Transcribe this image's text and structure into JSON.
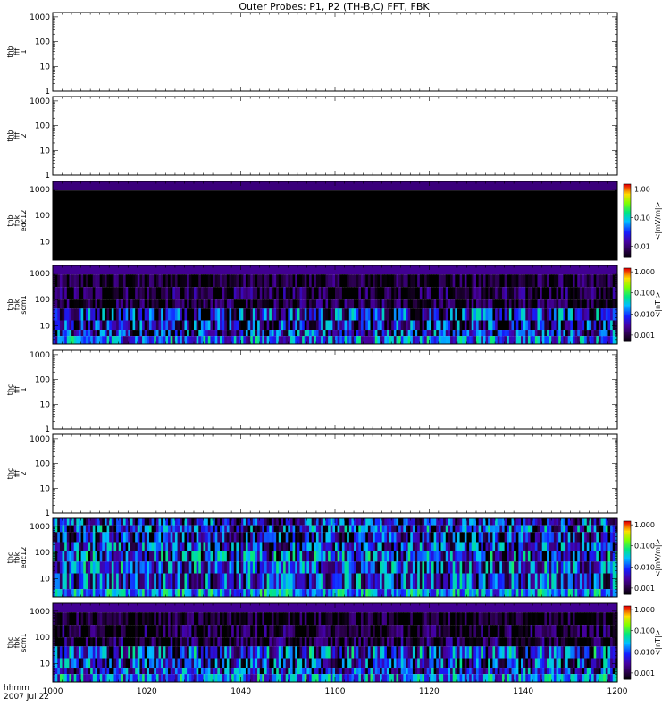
{
  "title": "Outer Probes: P1, P2 (TH-B,C) FFT, FBK",
  "footer": {
    "line1": "hhmm",
    "line2": "2007 Jul 22"
  },
  "colorbars": {
    "efield": {
      "unit": "<|mV/m|>",
      "ticks": [
        "1.00",
        "0.10",
        "0.01"
      ]
    },
    "efield_b": {
      "unit": "<|mV/m|>",
      "ticks": [
        "1.000",
        "0.100",
        "0.010",
        "0.001"
      ]
    },
    "bfield": {
      "unit": "<|nT|>",
      "ticks": [
        "1.000",
        "0.100",
        "0.010",
        "0.001"
      ]
    }
  },
  "chart_data": [
    {
      "type": "heatmap",
      "panel": "thb-fff-1",
      "ylabel": [
        "thb",
        "fff",
        "1"
      ],
      "yscale": "log",
      "ylim": [
        1,
        1500
      ],
      "ytick_labels": [
        "1000",
        "100",
        "10",
        "1"
      ],
      "xlim": [
        1000,
        1200
      ],
      "has_data": false,
      "colorbar": null
    },
    {
      "type": "heatmap",
      "panel": "thb-fff-2",
      "ylabel": [
        "thb",
        "fff",
        "2"
      ],
      "yscale": "log",
      "ylim": [
        1,
        1500
      ],
      "ytick_labels": [
        "1000",
        "100",
        "10",
        "1"
      ],
      "xlim": [
        1000,
        1200
      ],
      "has_data": false,
      "colorbar": null
    },
    {
      "type": "heatmap",
      "panel": "thb-fbk-edc12",
      "ylabel": [
        "thb",
        "fbk",
        "edc12"
      ],
      "yscale": "log",
      "ylim": [
        2,
        2000
      ],
      "ytick_labels": [
        "1000",
        "100",
        "10"
      ],
      "xlim": [
        1000,
        1200
      ],
      "has_data": true,
      "colorbar": "efield",
      "color_scale": "log",
      "zlim": [
        0.004,
        1.5
      ],
      "bands": [
        {
          "yrange": [
            900,
            2000
          ],
          "level": 0.011,
          "noise": 0.0
        },
        {
          "yrange": [
            2,
            900
          ],
          "level": 0.0,
          "noise": 0.0
        }
      ]
    },
    {
      "type": "heatmap",
      "panel": "thb-fbk-scm1",
      "ylabel": [
        "thb",
        "fbk",
        "scm1"
      ],
      "yscale": "log",
      "ylim": [
        2,
        2000
      ],
      "ytick_labels": [
        "1000",
        "100",
        "10"
      ],
      "xlim": [
        1000,
        1200
      ],
      "has_data": true,
      "colorbar": "bfield",
      "color_scale": "log",
      "zlim": [
        0.0005,
        1.5
      ],
      "bands": [
        {
          "yrange": [
            900,
            2000
          ],
          "level": 0.0025,
          "noise": 0.0
        },
        {
          "yrange": [
            300,
            900
          ],
          "level": 0.0008,
          "noise": 0.25
        },
        {
          "yrange": [
            100,
            300
          ],
          "level": 0.0009,
          "noise": 0.3
        },
        {
          "yrange": [
            45,
            100
          ],
          "level": 0.0008,
          "noise": 0.3
        },
        {
          "yrange": [
            16,
            45
          ],
          "level": 0.004,
          "noise": 0.55
        },
        {
          "yrange": [
            7,
            16
          ],
          "level": 0.003,
          "noise": 0.55
        },
        {
          "yrange": [
            4,
            7
          ],
          "level": 0.004,
          "noise": 0.5
        },
        {
          "yrange": [
            2,
            4
          ],
          "level": 0.012,
          "noise": 0.4
        }
      ]
    },
    {
      "type": "heatmap",
      "panel": "thc-fff-1",
      "ylabel": [
        "thc",
        "fff",
        "1"
      ],
      "yscale": "log",
      "ylim": [
        1,
        1500
      ],
      "ytick_labels": [
        "1000",
        "100",
        "10",
        "1"
      ],
      "xlim": [
        1000,
        1200
      ],
      "has_data": false,
      "colorbar": null
    },
    {
      "type": "heatmap",
      "panel": "thc-fff-2",
      "ylabel": [
        "thc",
        "fff",
        "2"
      ],
      "yscale": "log",
      "ylim": [
        1,
        1500
      ],
      "ytick_labels": [
        "1000",
        "100",
        "10",
        "1"
      ],
      "xlim": [
        1000,
        1200
      ],
      "has_data": false,
      "colorbar": null
    },
    {
      "type": "heatmap",
      "panel": "thc-fbk-edc12",
      "ylabel": [
        "thc",
        "fbk",
        "edc12"
      ],
      "yscale": "log",
      "ylim": [
        2,
        2000
      ],
      "ytick_labels": [
        "1000",
        "100",
        "10"
      ],
      "xlim": [
        1000,
        1200
      ],
      "has_data": true,
      "colorbar": "efield_b",
      "color_scale": "log",
      "zlim": [
        0.0005,
        1.5
      ],
      "bands": [
        {
          "yrange": [
            1100,
            2000
          ],
          "level": 0.004,
          "noise": 0.5
        },
        {
          "yrange": [
            600,
            1100
          ],
          "level": 0.005,
          "noise": 0.55
        },
        {
          "yrange": [
            250,
            600
          ],
          "level": 0.003,
          "noise": 0.5
        },
        {
          "yrange": [
            110,
            250
          ],
          "level": 0.004,
          "noise": 0.55
        },
        {
          "yrange": [
            45,
            110
          ],
          "level": 0.006,
          "noise": 0.55
        },
        {
          "yrange": [
            16,
            45
          ],
          "level": 0.007,
          "noise": 0.5
        },
        {
          "yrange": [
            4,
            16
          ],
          "level": 0.006,
          "noise": 0.5
        },
        {
          "yrange": [
            2,
            4
          ],
          "level": 0.02,
          "noise": 0.35
        }
      ]
    },
    {
      "type": "heatmap",
      "panel": "thc-fbk-scm1",
      "ylabel": [
        "thc",
        "fbk",
        "scm1"
      ],
      "yscale": "log",
      "ylim": [
        2,
        2000
      ],
      "ytick_labels": [
        "1000",
        "100",
        "10"
      ],
      "xlim": [
        1000,
        1200
      ],
      "has_data": true,
      "colorbar": "bfield",
      "color_scale": "log",
      "zlim": [
        0.0005,
        1.5
      ],
      "bands": [
        {
          "yrange": [
            900,
            2000
          ],
          "level": 0.0025,
          "noise": 0.0
        },
        {
          "yrange": [
            300,
            900
          ],
          "level": 0.0007,
          "noise": 0.25
        },
        {
          "yrange": [
            100,
            300
          ],
          "level": 0.0008,
          "noise": 0.3
        },
        {
          "yrange": [
            45,
            100
          ],
          "level": 0.0009,
          "noise": 0.3
        },
        {
          "yrange": [
            16,
            45
          ],
          "level": 0.006,
          "noise": 0.55
        },
        {
          "yrange": [
            7,
            16
          ],
          "level": 0.004,
          "noise": 0.55
        },
        {
          "yrange": [
            4,
            7
          ],
          "level": 0.005,
          "noise": 0.5
        },
        {
          "yrange": [
            2,
            4
          ],
          "level": 0.015,
          "noise": 0.4
        }
      ]
    }
  ],
  "x_axis": {
    "ticks": [
      1000,
      1020,
      1040,
      1100,
      1120,
      1140,
      1200
    ]
  }
}
